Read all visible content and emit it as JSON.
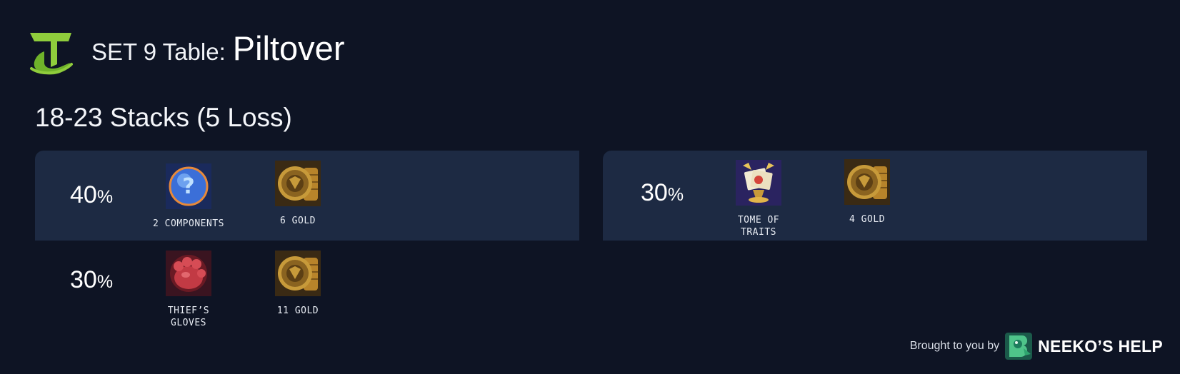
{
  "header": {
    "logo": "tactics-logo-icon",
    "title_prefix": "SET 9 Table:",
    "title_name": "Piltover"
  },
  "subtitle": "18-23 Stacks (5 Loss)",
  "outcomes": [
    {
      "percent": "40",
      "percent_sign": "%",
      "items": [
        {
          "icon": "component-anvil-icon",
          "label": "2 COMPONENTS"
        },
        {
          "icon": "gold-coins-icon",
          "label": "6 GOLD"
        }
      ]
    },
    {
      "percent": "30",
      "percent_sign": "%",
      "items": [
        {
          "icon": "tome-of-traits-icon",
          "label": "TOME OF TRAITS"
        },
        {
          "icon": "gold-coins-icon",
          "label": "4 GOLD"
        }
      ]
    },
    {
      "percent": "30",
      "percent_sign": "%",
      "items": [
        {
          "icon": "thiefs-gloves-icon",
          "label": "THIEF’S GLOVES"
        },
        {
          "icon": "gold-coins-icon",
          "label": "11 GOLD"
        }
      ]
    }
  ],
  "footer": {
    "text": "Brought to you by",
    "brand": "NEEKO’S HELP",
    "logo": "neeko-logo-icon"
  },
  "colors": {
    "background": "#0e1424",
    "panel": "#1d2a43",
    "logo_green": "#8fcd3c"
  }
}
